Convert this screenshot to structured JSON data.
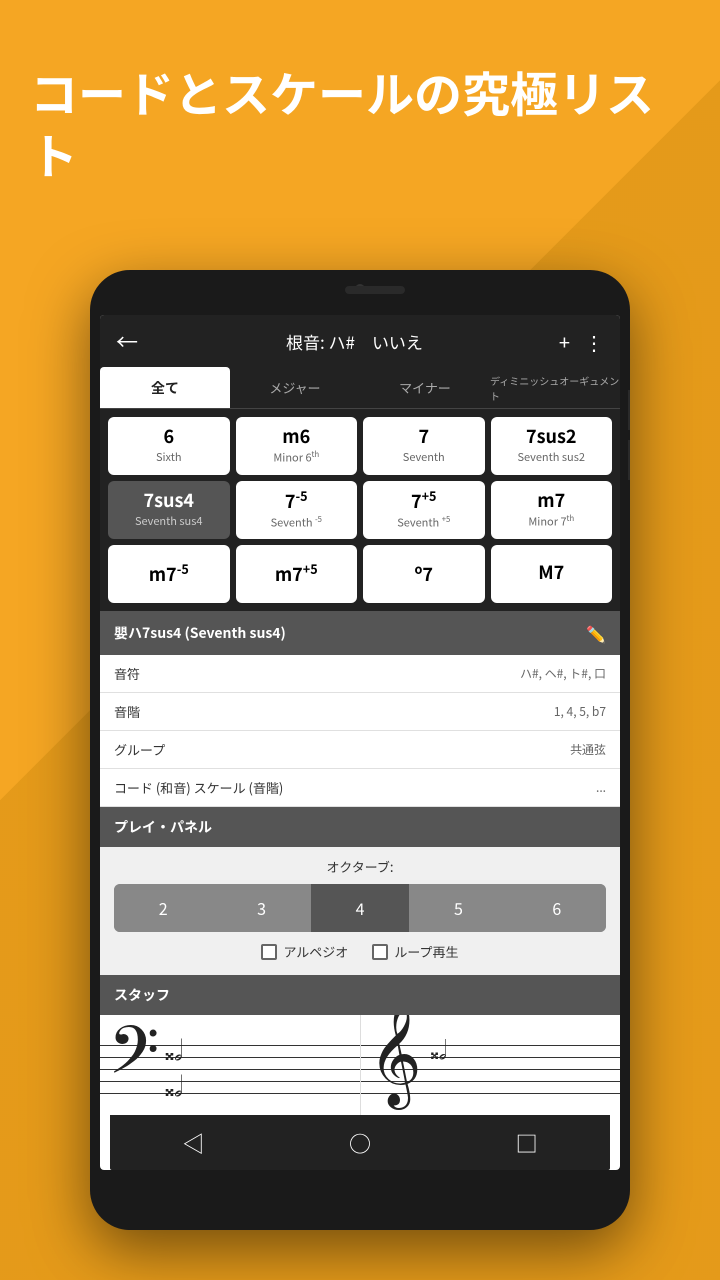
{
  "background_color": "#F5A623",
  "header": {
    "title": "コードとスケールの究極リスト"
  },
  "phone": {
    "top_bar": {
      "back_icon": "←",
      "title": "根音: ハ#　いいえ",
      "add_icon": "+",
      "menu_icon": "⋮"
    },
    "tabs": [
      {
        "label": "全て",
        "active": true
      },
      {
        "label": "メジャー",
        "active": false
      },
      {
        "label": "マイナー",
        "active": false
      },
      {
        "label": "ディミニッシュオーギュメント",
        "active": false
      }
    ],
    "chord_grid": [
      {
        "main": "6",
        "sub": "Sixth",
        "active": false
      },
      {
        "main": "m6",
        "sub": "Minor 6th",
        "active": false
      },
      {
        "main": "7",
        "sub": "Seventh",
        "active": false
      },
      {
        "main": "7sus2",
        "sub": "Seventh sus2",
        "active": false
      },
      {
        "main": "7sus4",
        "sub": "Seventh sus4",
        "active": true
      },
      {
        "main": "7-5",
        "sub": "Seventh -5",
        "active": false
      },
      {
        "main": "7+5",
        "sub": "Seventh +5",
        "active": false
      },
      {
        "main": "m7",
        "sub": "Minor 7th",
        "active": false
      },
      {
        "main": "m7-5",
        "sub": "",
        "active": false
      },
      {
        "main": "m7+5",
        "sub": "",
        "active": false
      },
      {
        "main": "o7",
        "sub": "",
        "active": false
      },
      {
        "main": "M7",
        "sub": "",
        "active": false
      }
    ],
    "info_panel": {
      "header_title": "嬰ハ7sus4 (Seventh sus4)",
      "rows": [
        {
          "label": "音符",
          "value": "ハ#, ヘ#, ト#, 口"
        },
        {
          "label": "音階",
          "value": "1, 4, 5, b7"
        },
        {
          "label": "グループ",
          "value": "共通弦"
        },
        {
          "label": "コード (和音) スケール (音階)",
          "value": "..."
        }
      ]
    },
    "play_panel": {
      "header_title": "プレイ・パネル",
      "octave_label": "オクターブ:",
      "octave_buttons": [
        "2",
        "3",
        "4",
        "5",
        "6"
      ],
      "active_octave": "4",
      "checkboxes": [
        {
          "label": "アルペジオ",
          "checked": false
        },
        {
          "label": "ループ再生",
          "checked": false
        }
      ]
    },
    "staff_panel": {
      "header_title": "スタッフ",
      "panels": [
        "bass",
        "treble"
      ]
    },
    "bottom_nav": {
      "back_icon": "◁",
      "home_icon": "○",
      "square_icon": "□"
    }
  }
}
